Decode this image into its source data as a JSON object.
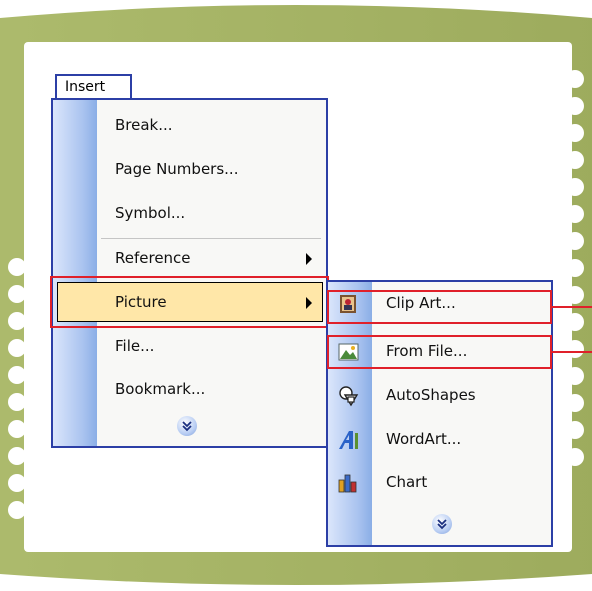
{
  "menubar": {
    "insert_label": "Insert"
  },
  "insert_menu": {
    "items": [
      {
        "label": "Break...",
        "has_submenu": false
      },
      {
        "label": "Page Numbers...",
        "has_submenu": false
      },
      {
        "label": "Symbol...",
        "has_submenu": false
      },
      {
        "label": "Reference",
        "has_submenu": true
      },
      {
        "label": "Picture",
        "has_submenu": true,
        "selected": true
      },
      {
        "label": "File...",
        "has_submenu": false
      },
      {
        "label": "Bookmark...",
        "has_submenu": false
      }
    ],
    "expand_icon": "double-chevron-down-icon"
  },
  "picture_submenu": {
    "items": [
      {
        "label": "Clip Art...",
        "icon": "clip-art-icon",
        "highlighted": true
      },
      {
        "label": "From File...",
        "icon": "from-file-icon",
        "highlighted": true
      },
      {
        "label": "AutoShapes",
        "icon": "autoshapes-icon"
      },
      {
        "label": "WordArt...",
        "icon": "wordart-icon"
      },
      {
        "label": "Chart",
        "icon": "chart-icon"
      }
    ],
    "expand_icon": "double-chevron-down-icon"
  },
  "colors": {
    "frame": "#a7b663",
    "menu_border": "#2c3fa6",
    "selected_bg": "#ffe7a8",
    "highlight_box": "#e0202a"
  }
}
